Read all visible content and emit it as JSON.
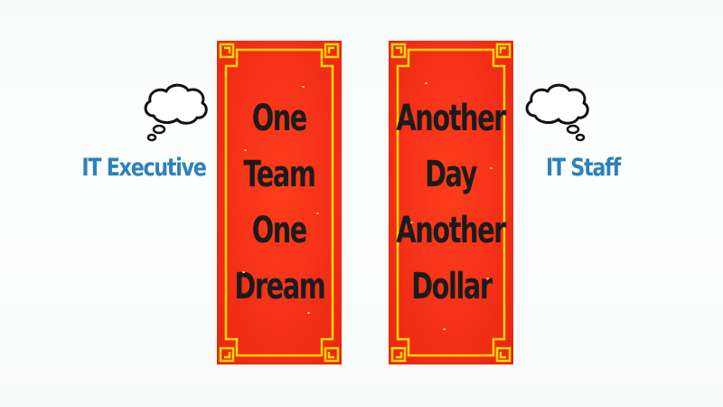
{
  "labels": {
    "left": "IT Executive",
    "right": "IT Staff"
  },
  "banners": {
    "left": {
      "lines": [
        "One",
        "Team",
        "One",
        "Dream"
      ]
    },
    "right": {
      "lines": [
        "Another",
        "Day",
        "Another",
        "Dollar"
      ]
    }
  },
  "icons": {
    "left": "thought-cloud-icon",
    "right": "thought-cloud-icon"
  },
  "colors": {
    "label": "#2c82b9",
    "banner_red": "#f7331a",
    "banner_border": "#ffd700",
    "banner_text": "#1b1b1b",
    "background": "#f8fbfa"
  }
}
